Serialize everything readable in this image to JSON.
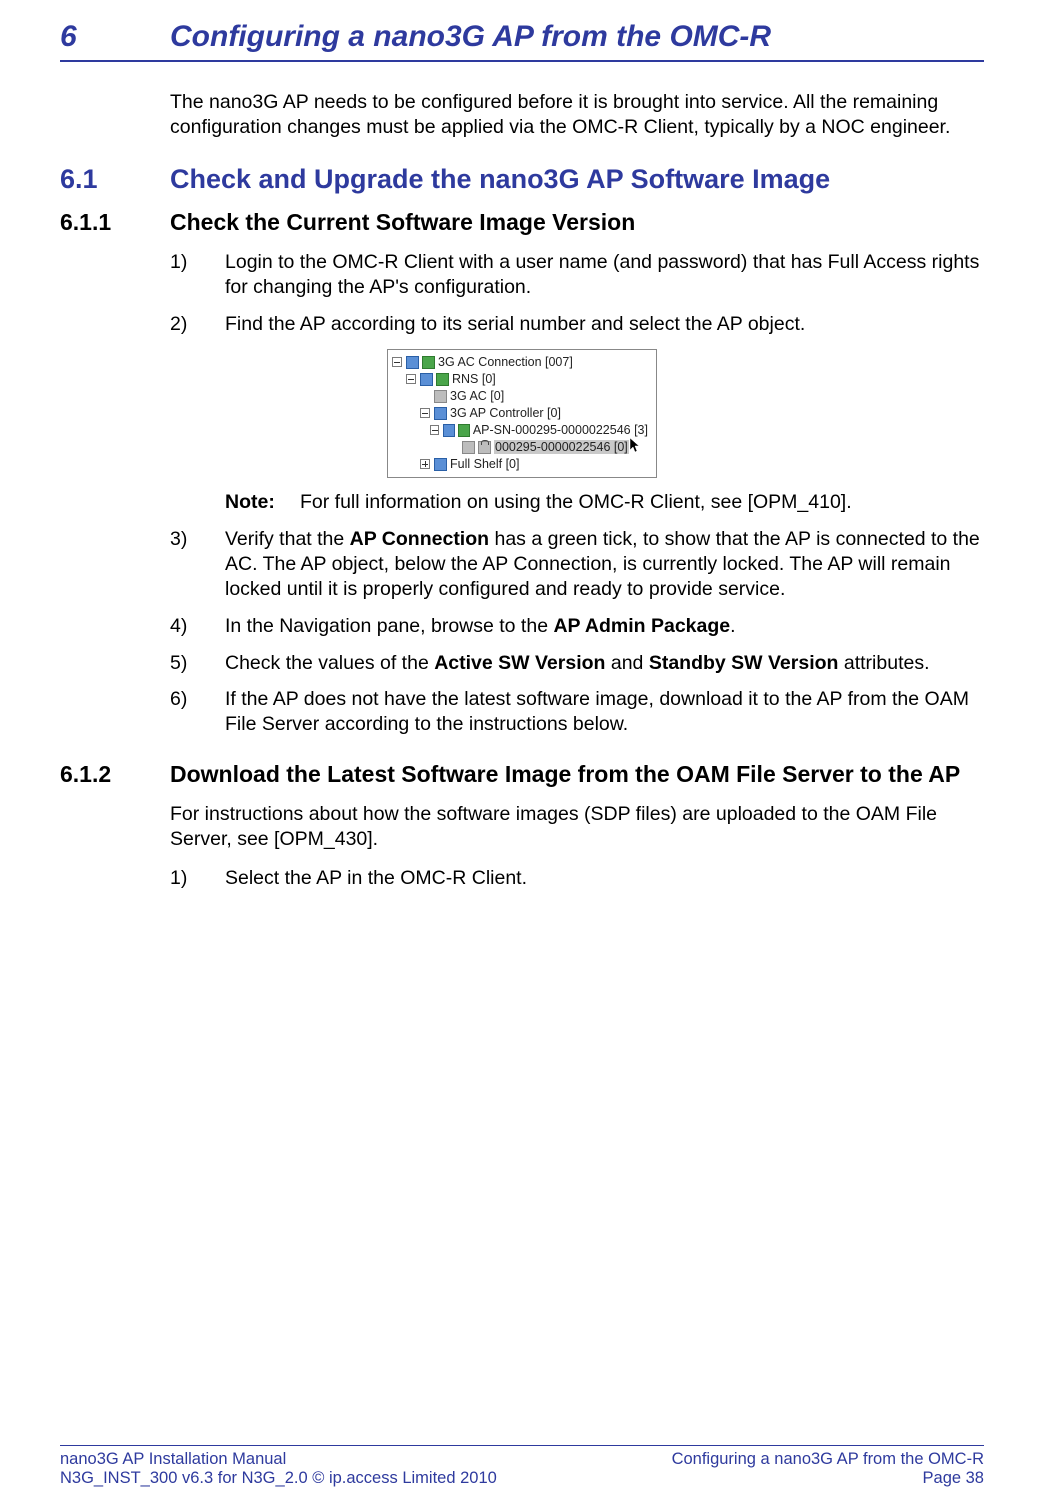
{
  "chapter": {
    "num": "6",
    "title": "Configuring a nano3G AP from the OMC-R"
  },
  "intro": "The nano3G AP needs to be configured before it is brought into service. All the remaining configuration changes must be applied via the OMC-R Client, typically by a NOC engineer.",
  "section_6_1": {
    "num": "6.1",
    "title": "Check and Upgrade the nano3G AP Software Image"
  },
  "section_6_1_1": {
    "num": "6.1.1",
    "title": "Check the Current Software Image Version"
  },
  "steps_6_1_1": {
    "s1": {
      "num": "1)",
      "text": "Login to the OMC-R Client with a user name (and password) that has Full Access rights for changing the AP's configuration."
    },
    "s2": {
      "num": "2)",
      "text": "Find the AP according to its serial number and select the AP object."
    },
    "s3": {
      "num": "3)",
      "pre": "Verify that the ",
      "b1": "AP Connection",
      "post": " has a green tick, to show that the AP is connected to the AC. The AP object, below the AP Connection, is currently locked. The AP will remain locked until it is properly configured and ready to provide service."
    },
    "s4": {
      "num": "4)",
      "pre": "In the Navigation pane, browse to the ",
      "b1": "AP Admin Package",
      "post": "."
    },
    "s5": {
      "num": "5)",
      "pre": "Check the values of the ",
      "b1": "Active SW Version",
      "mid": " and ",
      "b2": "Standby SW Version",
      "post": " attributes."
    },
    "s6": {
      "num": "6)",
      "text": "If the AP does not have the latest software image, download it to the AP from the OAM File Server according to the instructions below."
    }
  },
  "tree": {
    "n1": "3G AC Connection [007]",
    "n2": "RNS [0]",
    "n3": "3G AC [0]",
    "n4": "3G AP Controller [0]",
    "n5": "AP-SN-000295-0000022546 [3]",
    "n6": "000295-0000022546 [0]",
    "n7": "Full Shelf [0]"
  },
  "note": {
    "label": "Note:",
    "text": "For full information on using the OMC-R Client, see [OPM_410]."
  },
  "section_6_1_2": {
    "num": "6.1.2",
    "title": "Download the Latest Software Image from the OAM File Server to the AP"
  },
  "body_6_1_2": "For instructions about how the software images (SDP files) are uploaded to the OAM File Server, see [OPM_430].",
  "steps_6_1_2": {
    "s1": {
      "num": "1)",
      "text": "Select the AP in the OMC-R Client."
    }
  },
  "footer": {
    "left1": "nano3G AP Installation Manual",
    "left2": "N3G_INST_300 v6.3 for N3G_2.0 © ip.access Limited 2010",
    "right1": "Configuring a nano3G AP from the OMC-R",
    "right2": "Page 38"
  }
}
